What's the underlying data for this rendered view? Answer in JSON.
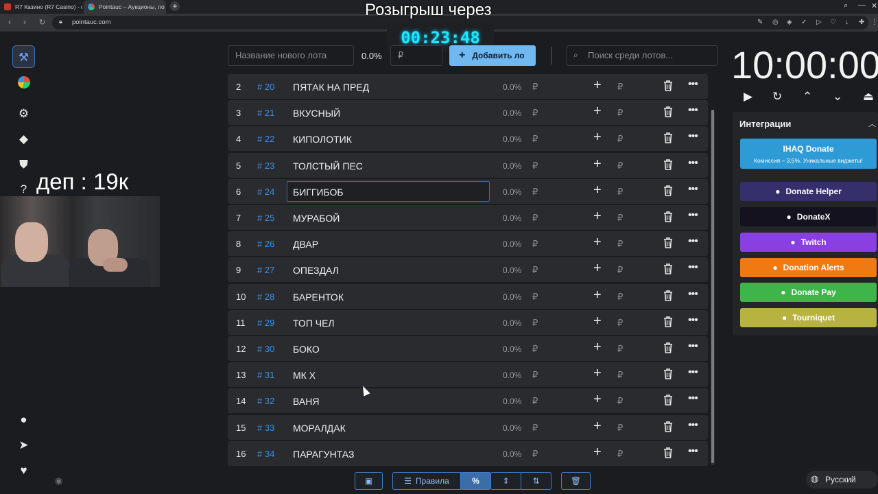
{
  "browser": {
    "tabs": [
      {
        "label": "R7 Казино (R7 Casino) - c"
      },
      {
        "label": "Pointauc – Аукционы, ло"
      }
    ],
    "url": "pointauc.com"
  },
  "overlay": {
    "title": "Розыгрыш через",
    "timer": "00:23:48",
    "dep_label": "деп : 19к"
  },
  "lot_form": {
    "name_placeholder": "Название нового лота",
    "percent": "0.0%",
    "amount_placeholder": "₽",
    "add_button": "Добавить ло",
    "search_placeholder": "Поиск среди лотов..."
  },
  "lots": [
    {
      "num": "2",
      "id": "# 20",
      "name": "ПЯТАК НА ПРЕД",
      "percent": "0.0%",
      "currency": "₽"
    },
    {
      "num": "3",
      "id": "# 21",
      "name": "ВКУСНЫЙ",
      "percent": "0.0%",
      "currency": "₽"
    },
    {
      "num": "4",
      "id": "# 22",
      "name": "КИПОЛОТИК",
      "percent": "0.0%",
      "currency": "₽"
    },
    {
      "num": "5",
      "id": "# 23",
      "name": "ТОЛСТЫЙ ПЕС",
      "percent": "0.0%",
      "currency": "₽"
    },
    {
      "num": "6",
      "id": "# 24",
      "name": "БИГГИБОБ",
      "percent": "0.0%",
      "currency": "₽"
    },
    {
      "num": "7",
      "id": "# 25",
      "name": "МУРАБОЙ",
      "percent": "0.0%",
      "currency": "₽"
    },
    {
      "num": "8",
      "id": "# 26",
      "name": "ДВАР",
      "percent": "0.0%",
      "currency": "₽"
    },
    {
      "num": "9",
      "id": "# 27",
      "name": "ОПЕЗДАЛ",
      "percent": "0.0%",
      "currency": "₽"
    },
    {
      "num": "10",
      "id": "# 28",
      "name": "БАРЕНТОК",
      "percent": "0.0%",
      "currency": "₽"
    },
    {
      "num": "11",
      "id": "# 29",
      "name": "ТОП ЧЕЛ",
      "percent": "0.0%",
      "currency": "₽"
    },
    {
      "num": "12",
      "id": "# 30",
      "name": "БОКО",
      "percent": "0.0%",
      "currency": "₽"
    },
    {
      "num": "13",
      "id": "# 31",
      "name": "МК Х",
      "percent": "0.0%",
      "currency": "₽"
    },
    {
      "num": "14",
      "id": "# 32",
      "name": "ВАНЯ",
      "percent": "0.0%",
      "currency": "₽"
    },
    {
      "num": "15",
      "id": "# 33",
      "name": "МОРАЛДАК",
      "percent": "0.0%",
      "currency": "₽"
    },
    {
      "num": "16",
      "id": "# 34",
      "name": "ПАРАГУНТАЗ",
      "percent": "0.0%",
      "currency": "₽"
    }
  ],
  "selected_lot_index": 4,
  "toolbar": {
    "rules_label": "Правила",
    "percent_label": "%"
  },
  "auction_timer": {
    "value": "10:00:00"
  },
  "integrations": {
    "title": "Интеграции",
    "items": [
      {
        "label": "IHAQ Donate",
        "sublabel": "Комиссия – 3,5%. Уникальные виджеты!",
        "color": "#2f9bd6"
      },
      {
        "label": "Donate Helper",
        "color": "#35306b"
      },
      {
        "label": "DonateX",
        "color": "#15121f"
      },
      {
        "label": "Twitch",
        "color": "#8a3fe0"
      },
      {
        "label": "Donation Alerts",
        "color": "#f07a12"
      },
      {
        "label": "Donate Pay",
        "color": "#3db54a"
      },
      {
        "label": "Tourniquet",
        "color": "#b7b33f"
      }
    ]
  },
  "language": "Русский"
}
